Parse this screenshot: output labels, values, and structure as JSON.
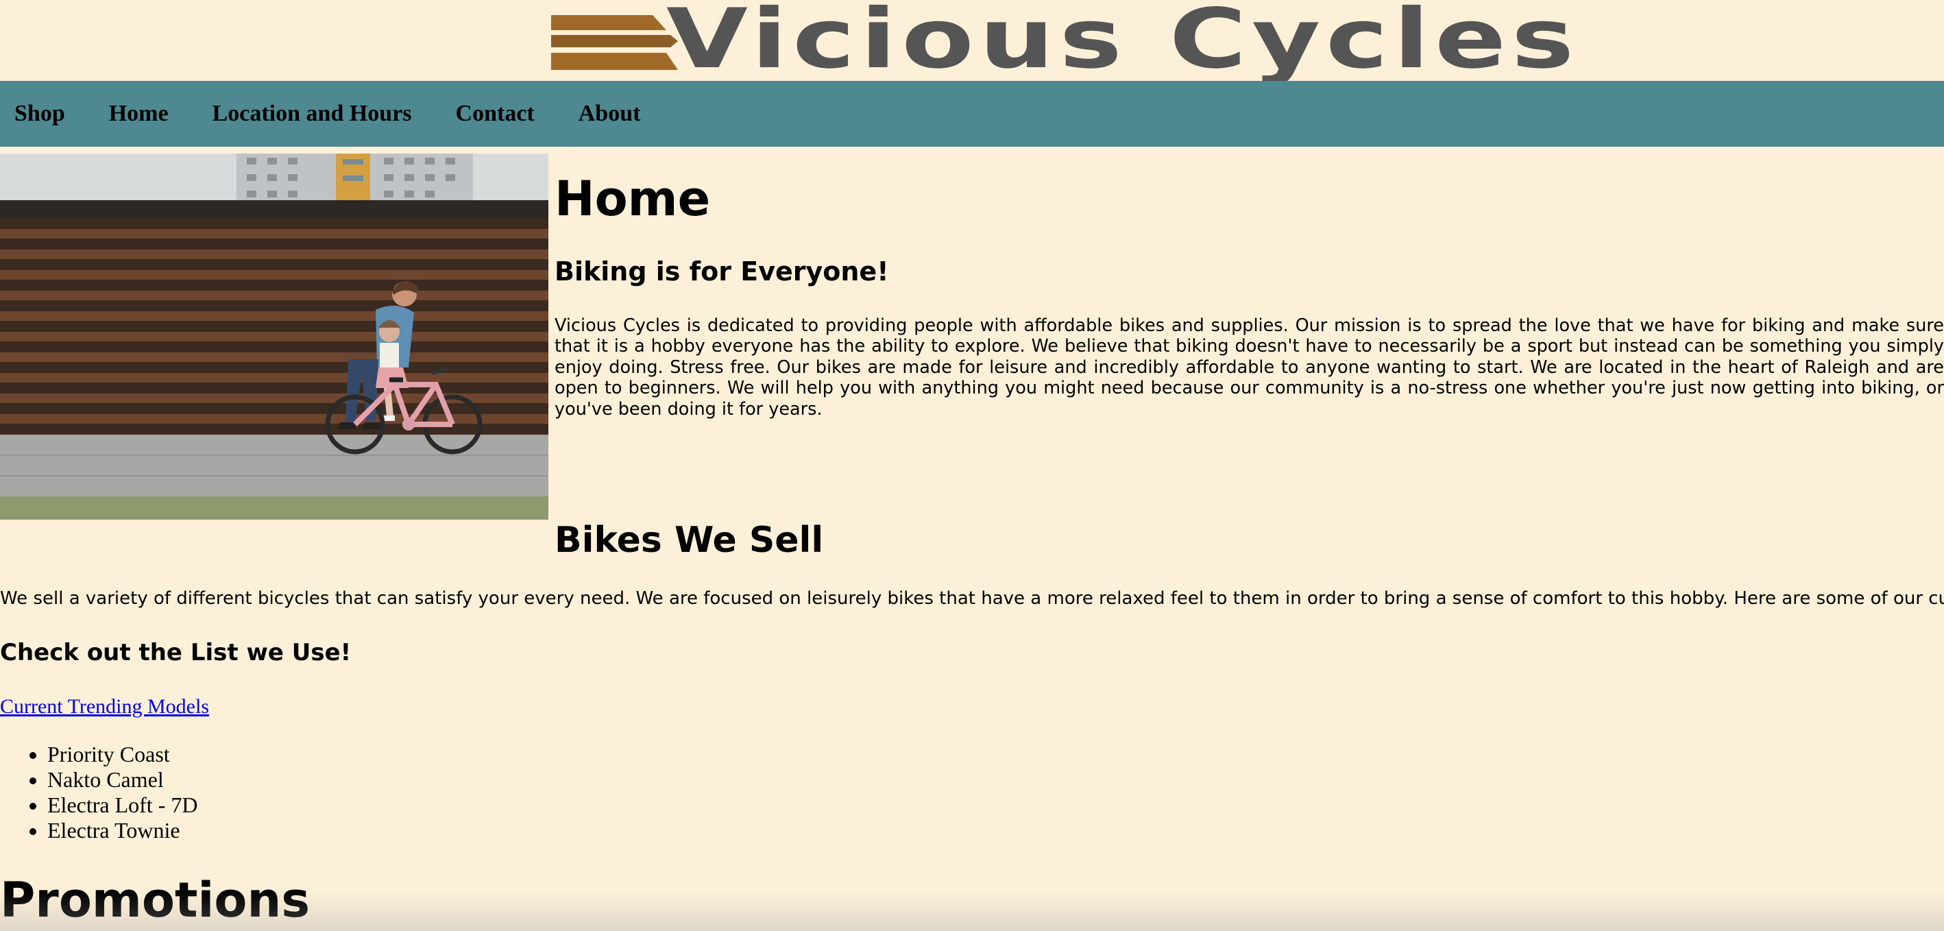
{
  "header": {
    "logo_text": "Vicious  Cycles",
    "logo_colors": {
      "stripes": "#a0692a",
      "text": "#555555"
    }
  },
  "nav": {
    "background": "#4e8890",
    "items": [
      {
        "label": "Shop"
      },
      {
        "label": "Home"
      },
      {
        "label": "Location and Hours"
      },
      {
        "label": "Contact"
      },
      {
        "label": "About"
      }
    ]
  },
  "hero": {
    "image_subject": "adult-teaching-child-to-ride-pink-bicycle"
  },
  "home": {
    "title": "Home",
    "subtitle": "Biking is for Everyone!",
    "paragraph": "Vicious Cycles is dedicated to providing people with affordable bikes and supplies. Our mission is to spread the love that we have for biking and make sure that it is a hobby everyone has the ability to explore. We believe that biking doesn't have to necessarily be a sport but instead can be something you simply enjoy doing. Stress free. Our bikes are made for leisure and incredibly affordable to anyone wanting to start. We are located in the heart of Raleigh and are open to beginners. We will help you with anything you might need because our community is a no-stress one whether you're just now getting into biking, or you've been doing it for years."
  },
  "bikes": {
    "title": "Bikes We Sell",
    "paragraph": "We sell a variety of different bicycles that can satisfy your every need. We are focused on leisurely bikes that have a more relaxed feel to them in order to bring a sense of comfort to this hobby. Here are some of our current bestsellers!",
    "list_heading": "Check out the List we Use!",
    "link_text": "Current Trending Models",
    "models": [
      "Priority Coast",
      "Nakto Camel",
      "Electra Loft - 7D",
      "Electra Townie"
    ]
  },
  "promotions": {
    "title": "Promotions"
  }
}
